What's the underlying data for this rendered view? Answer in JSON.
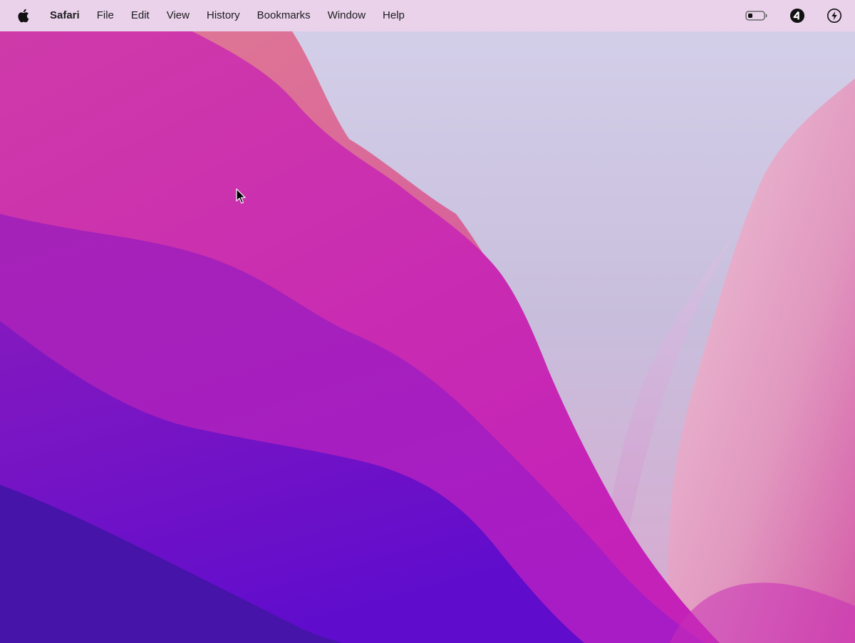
{
  "menubar": {
    "apple_icon": "apple-logo-icon",
    "app_name": "Safari",
    "items": [
      "File",
      "Edit",
      "View",
      "History",
      "Bookmarks",
      "Window",
      "Help"
    ],
    "status_icons": [
      "battery-low-icon",
      "circled-4-icon",
      "lightning-bolt-icon"
    ]
  },
  "wallpaper": {
    "colors": {
      "sky": "#c9c6e0",
      "peak_pink": "#d86f9a",
      "magenta": "#c432ad",
      "purple": "#9b1fc4",
      "violet": "#5a12c9",
      "deep_indigo": "#3b13a5",
      "right_pink": "#e3a3c6"
    }
  },
  "cursor": {
    "icon": "pointer-cursor-icon"
  }
}
